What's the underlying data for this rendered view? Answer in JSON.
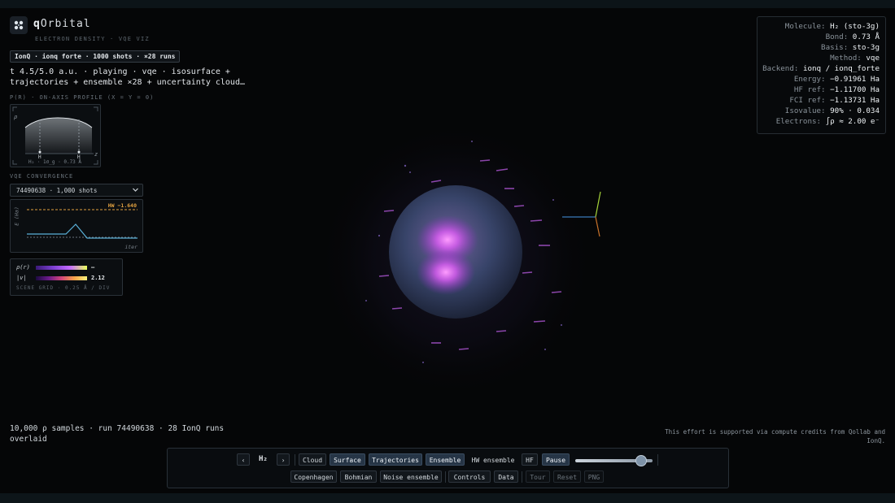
{
  "brand": {
    "title_bold": "q",
    "title_rest": "Orbital",
    "subtitle": "ELECTRON DENSITY · VQE VIZ",
    "icon": "orbital-grid-icon"
  },
  "run_pill": "IonQ · ionq forte · 1000 shots · ×28 runs",
  "status_text": "t 4.5/5.0 a.u. · playing · vqe · isosurface + trajectories + ensemble ×28 + uncertainty cloud…",
  "profile": {
    "label": "P(R) · ON-AXIS PROFILE (X = Y = 0)",
    "y_axis": "ρ",
    "x_axis": "z",
    "marker": "H",
    "caption": "H₂ · 1σ_g · 0.73 Å"
  },
  "vqe": {
    "label": "VQE CONVERGENCE",
    "select_value": "74490638 · 1,000 shots",
    "hw_label": "HW −1.640",
    "y_axis": "E (Ha)",
    "x_axis": "iter"
  },
  "legend": {
    "density_label": "ρ(r)",
    "density_value": "—",
    "velocity_label": "|v|",
    "velocity_value": "2.12",
    "grid_note": "SCENE GRID · 0.25 Å / DIV"
  },
  "info": [
    {
      "k": "Molecule:",
      "v": "H₂ (sto-3g)"
    },
    {
      "k": "Bond:",
      "v": "0.73 Å"
    },
    {
      "k": "Basis:",
      "v": "sto-3g"
    },
    {
      "k": "Method:",
      "v": "vqe"
    },
    {
      "k": "Backend:",
      "v": "ionq / ionq_forte"
    },
    {
      "k": "Energy:",
      "v": "−0.91961 Ha"
    },
    {
      "k": "HF ref:",
      "v": "−1.11700 Ha"
    },
    {
      "k": "FCI ref:",
      "v": "−1.13731 Ha"
    },
    {
      "k": "Isovalue:",
      "v": "90% · 0.034"
    },
    {
      "k": "Electrons:",
      "v": "∫ρ ≈ 2.00 e⁻"
    }
  ],
  "samples_text": "10,000 ρ samples · run 74490638 · 28 IonQ runs overlaid",
  "credits_text": "This effort is supported via compute credits from Qollab and IonQ.",
  "controls": {
    "prev": "‹",
    "molecule": "H₂",
    "next": "›",
    "row1": [
      "Cloud",
      "Surface",
      "Trajectories",
      "Ensemble",
      "HW ensemble",
      "HF",
      "Pause"
    ],
    "row2": [
      "Copenhagen",
      "Bohmian",
      "Noise ensemble",
      "Controls",
      "Data",
      "Tour",
      "Reset",
      "PNG"
    ],
    "slider_value": 0.9
  },
  "colors": {
    "accent": "#c56bff",
    "hw_line": "#e0a040",
    "vqe_line": "#5ab0d8"
  }
}
